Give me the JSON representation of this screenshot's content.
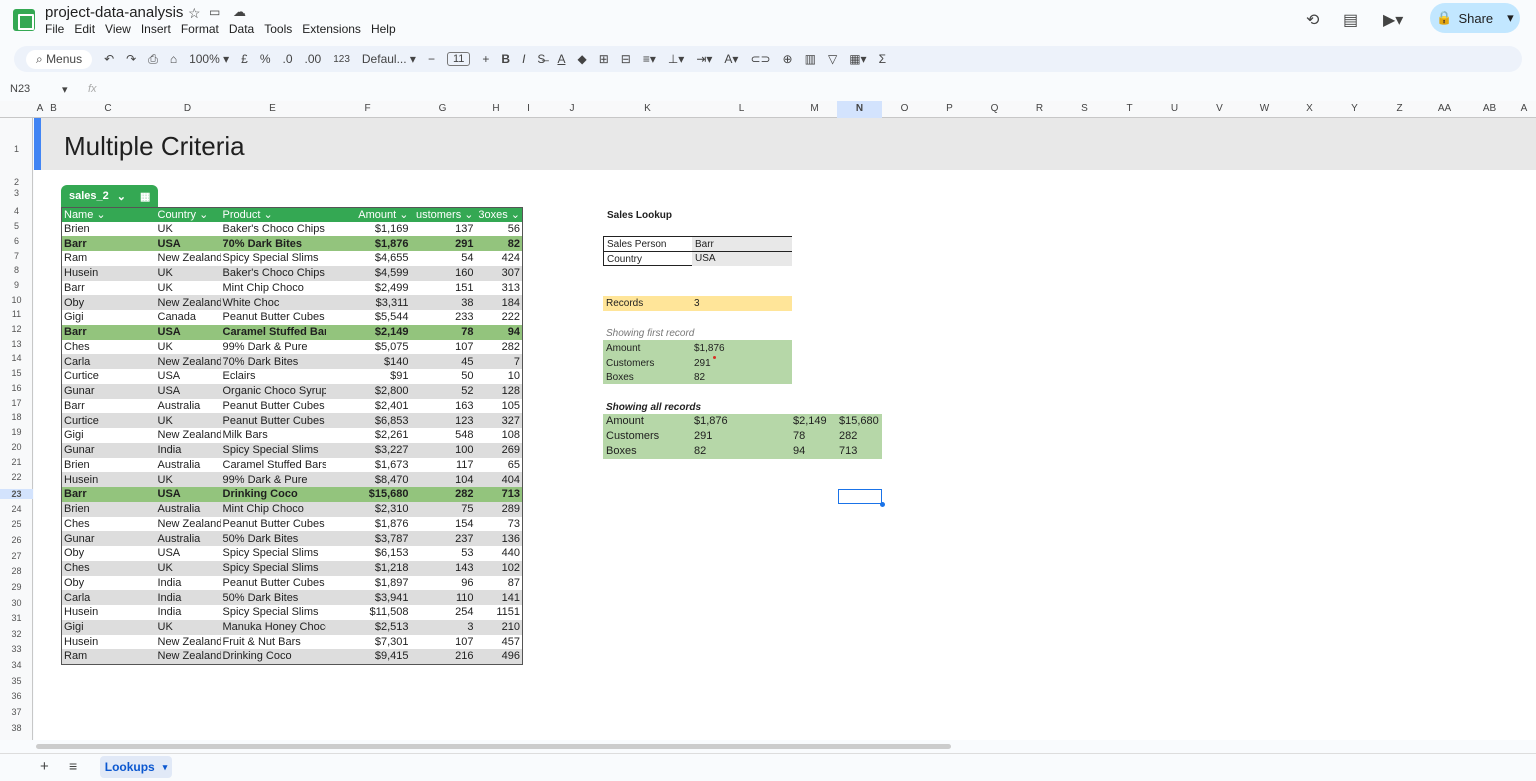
{
  "doc": {
    "title": "project-data-analysis",
    "menus": [
      "File",
      "Edit",
      "View",
      "Insert",
      "Format",
      "Data",
      "Tools",
      "Extensions",
      "Help"
    ],
    "share": "Share"
  },
  "toolbar": {
    "menus": "Menus",
    "zoom": "100%",
    "currency": "£",
    "percent": "%",
    "dec1": ".0",
    "dec2": ".00",
    "fmt": "123",
    "font": "Defaul...",
    "size": "11",
    "bold": "B",
    "italic": "I"
  },
  "formula": {
    "cellref": "N23",
    "fx": "fx"
  },
  "columns": [
    "A",
    "B",
    "C",
    "D",
    "E",
    "F",
    "G",
    "H",
    "I",
    "J",
    "K",
    "L",
    "M",
    "N",
    "O",
    "P",
    "Q",
    "R",
    "S",
    "T",
    "U",
    "V",
    "W",
    "X",
    "Y",
    "Z",
    "AA",
    "AB",
    "A"
  ],
  "sheet": {
    "title": "Multiple Criteria",
    "table_name": "sales_2",
    "headers": [
      "Name",
      "Country",
      "Product",
      "Amount",
      "ustomers",
      "3oxes"
    ],
    "rows": [
      [
        "Brien",
        "UK",
        "Baker's Choco Chips",
        "$1,169",
        "137",
        "56"
      ],
      [
        "Barr",
        "USA",
        "70% Dark Bites",
        "$1,876",
        "291",
        "82"
      ],
      [
        "Ram",
        "New Zealand",
        "Spicy Special Slims",
        "$4,655",
        "54",
        "424"
      ],
      [
        "Husein",
        "UK",
        "Baker's Choco Chips",
        "$4,599",
        "160",
        "307"
      ],
      [
        "Barr",
        "UK",
        "Mint Chip Choco",
        "$2,499",
        "151",
        "313"
      ],
      [
        "Oby",
        "New Zealand",
        "White Choc",
        "$3,311",
        "38",
        "184"
      ],
      [
        "Gigi",
        "Canada",
        "Peanut Butter Cubes",
        "$5,544",
        "233",
        "222"
      ],
      [
        "Barr",
        "USA",
        "Caramel Stuffed Bars",
        "$2,149",
        "78",
        "94"
      ],
      [
        "Ches",
        "UK",
        "99% Dark & Pure",
        "$5,075",
        "107",
        "282"
      ],
      [
        "Carla",
        "New Zealand",
        "70% Dark Bites",
        "$140",
        "45",
        "7"
      ],
      [
        "Curtice",
        "USA",
        "Eclairs",
        "$91",
        "50",
        "10"
      ],
      [
        "Gunar",
        "USA",
        "Organic Choco Syrup",
        "$2,800",
        "52",
        "128"
      ],
      [
        "Barr",
        "Australia",
        "Peanut Butter Cubes",
        "$2,401",
        "163",
        "105"
      ],
      [
        "Curtice",
        "UK",
        "Peanut Butter Cubes",
        "$6,853",
        "123",
        "327"
      ],
      [
        "Gigi",
        "New Zealand",
        "Milk Bars",
        "$2,261",
        "548",
        "108"
      ],
      [
        "Gunar",
        "India",
        "Spicy Special Slims",
        "$3,227",
        "100",
        "269"
      ],
      [
        "Brien",
        "Australia",
        "Caramel Stuffed Bars",
        "$1,673",
        "117",
        "65"
      ],
      [
        "Husein",
        "UK",
        "99% Dark & Pure",
        "$8,470",
        "104",
        "404"
      ],
      [
        "Barr",
        "USA",
        "Drinking Coco",
        "$15,680",
        "282",
        "713"
      ],
      [
        "Brien",
        "Australia",
        "Mint Chip Choco",
        "$2,310",
        "75",
        "289"
      ],
      [
        "Ches",
        "New Zealand",
        "Peanut Butter Cubes",
        "$1,876",
        "154",
        "73"
      ],
      [
        "Gunar",
        "Australia",
        "50% Dark Bites",
        "$3,787",
        "237",
        "136"
      ],
      [
        "Oby",
        "USA",
        "Spicy Special Slims",
        "$6,153",
        "53",
        "440"
      ],
      [
        "Ches",
        "UK",
        "Spicy Special Slims",
        "$1,218",
        "143",
        "102"
      ],
      [
        "Oby",
        "India",
        "Peanut Butter Cubes",
        "$1,897",
        "96",
        "87"
      ],
      [
        "Carla",
        "India",
        "50% Dark Bites",
        "$3,941",
        "110",
        "141"
      ],
      [
        "Husein",
        "India",
        "Spicy Special Slims",
        "$11,508",
        "254",
        "1151"
      ],
      [
        "Gigi",
        "UK",
        "Manuka Honey Choco",
        "$2,513",
        "3",
        "210"
      ],
      [
        "Husein",
        "New Zealand",
        "Fruit & Nut Bars",
        "$7,301",
        "107",
        "457"
      ],
      [
        "Ram",
        "New Zealand",
        "Drinking Coco",
        "$9,415",
        "216",
        "496"
      ]
    ],
    "highlight_rows": [
      1,
      7,
      18
    ]
  },
  "lookup": {
    "heading": "Sales Lookup",
    "sp_label": "Sales Person",
    "sp_val": "Barr",
    "country_label": "Country",
    "country_val": "USA",
    "records_label": "Records",
    "records_val": "3",
    "first_heading": "Showing first record",
    "first": [
      [
        "Amount",
        "$1,876"
      ],
      [
        "Customers",
        "291"
      ],
      [
        "Boxes",
        "82"
      ]
    ],
    "all_heading": "Showing all records",
    "all": [
      [
        "Amount",
        "$1,876",
        "$2,149",
        "$15,680"
      ],
      [
        "Customers",
        "291",
        "78",
        "282"
      ],
      [
        "Boxes",
        "82",
        "94",
        "713"
      ]
    ]
  },
  "tabs": {
    "active": "Lookups"
  }
}
